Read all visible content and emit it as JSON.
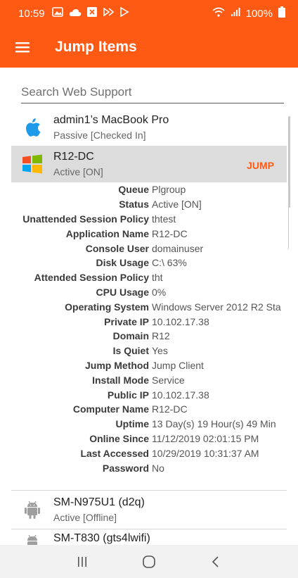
{
  "status_bar": {
    "time": "10:59",
    "battery": "100%",
    "icons": [
      "gallery-icon",
      "cloud-icon",
      "close-box-icon",
      "wifi-calling-icon",
      "play-icon"
    ]
  },
  "app_bar": {
    "title": "Jump Items"
  },
  "search": {
    "placeholder": "Search Web Support"
  },
  "items": [
    {
      "name": "admin1’s MacBook Pro",
      "status": "Passive [Checked In]",
      "icon": "apple-icon"
    },
    {
      "name": "R12-DC",
      "status": "Active [ON]",
      "icon": "windows-icon",
      "action": "JUMP"
    },
    {
      "name": "SM-N975U1 (d2q)",
      "status": "Active [Offline]",
      "icon": "android-icon"
    },
    {
      "name": "SM-T830 (gts4lwifi)",
      "status": "",
      "icon": "android-icon"
    }
  ],
  "details": [
    {
      "label": "Queue",
      "value": "Plgroup"
    },
    {
      "label": "Status",
      "value": "Active [ON]"
    },
    {
      "label": "Unattended Session Policy",
      "value": "thtest"
    },
    {
      "label": "Application Name",
      "value": "R12-DC"
    },
    {
      "label": "Console User",
      "value": "domainuser"
    },
    {
      "label": "Disk Usage",
      "value": "C:\\ 63%"
    },
    {
      "label": "Attended Session Policy",
      "value": "tht"
    },
    {
      "label": "CPU Usage",
      "value": "0%"
    },
    {
      "label": "Operating System",
      "value": "Windows Server 2012 R2 Sta"
    },
    {
      "label": "Private IP",
      "value": "10.102.17.38"
    },
    {
      "label": "Domain",
      "value": "R12"
    },
    {
      "label": "Is Quiet",
      "value": "Yes"
    },
    {
      "label": "Jump Method",
      "value": "Jump Client"
    },
    {
      "label": "Install Mode",
      "value": "Service"
    },
    {
      "label": "Public IP",
      "value": "10.102.17.38"
    },
    {
      "label": "Computer Name",
      "value": "R12-DC"
    },
    {
      "label": "Uptime",
      "value": "13 Day(s) 19 Hour(s) 49 Min"
    },
    {
      "label": "Online Since",
      "value": "11/12/2019 02:01:15 PM"
    },
    {
      "label": "Last Accessed",
      "value": "10/29/2019 10:31:37 AM"
    },
    {
      "label": "Password",
      "value": "No"
    }
  ],
  "colors": {
    "accent": "#ff5a14",
    "selected_bg": "#dcdcdc"
  }
}
